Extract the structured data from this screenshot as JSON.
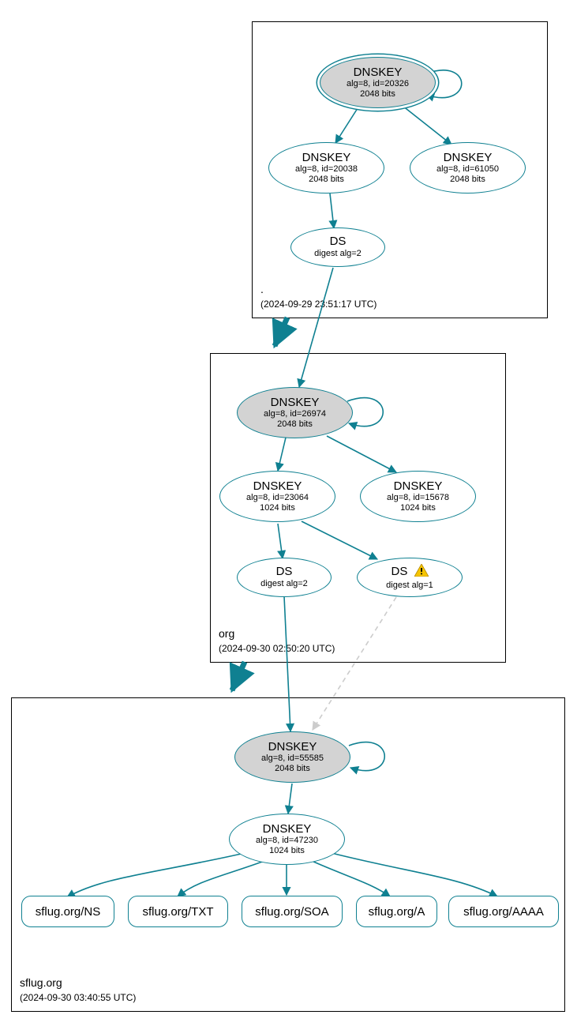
{
  "colors": {
    "stroke": "#0f8091",
    "insecure": "#cccccc"
  },
  "zones": {
    "root": {
      "name": ".",
      "timestamp": "(2024-09-29 23:51:17 UTC)"
    },
    "org": {
      "name": "org",
      "timestamp": "(2024-09-30 02:50:20 UTC)"
    },
    "sflug": {
      "name": "sflug.org",
      "timestamp": "(2024-09-30 03:40:55 UTC)"
    }
  },
  "nodes": {
    "root_ksk": {
      "title": "DNSKEY",
      "l1": "alg=8, id=20326",
      "l2": "2048 bits"
    },
    "root_zsk1": {
      "title": "DNSKEY",
      "l1": "alg=8, id=20038",
      "l2": "2048 bits"
    },
    "root_zsk2": {
      "title": "DNSKEY",
      "l1": "alg=8, id=61050",
      "l2": "2048 bits"
    },
    "root_ds": {
      "title": "DS",
      "l1": "digest alg=2"
    },
    "org_ksk": {
      "title": "DNSKEY",
      "l1": "alg=8, id=26974",
      "l2": "2048 bits"
    },
    "org_zsk1": {
      "title": "DNSKEY",
      "l1": "alg=8, id=23064",
      "l2": "1024 bits"
    },
    "org_zsk2": {
      "title": "DNSKEY",
      "l1": "alg=8, id=15678",
      "l2": "1024 bits"
    },
    "org_ds2": {
      "title": "DS",
      "l1": "digest alg=2"
    },
    "org_ds1": {
      "title": "DS",
      "l1": "digest alg=1"
    },
    "sflug_ksk": {
      "title": "DNSKEY",
      "l1": "alg=8, id=55585",
      "l2": "2048 bits"
    },
    "sflug_zsk": {
      "title": "DNSKEY",
      "l1": "alg=8, id=47230",
      "l2": "1024 bits"
    },
    "rr_ns": {
      "label": "sflug.org/NS"
    },
    "rr_txt": {
      "label": "sflug.org/TXT"
    },
    "rr_soa": {
      "label": "sflug.org/SOA"
    },
    "rr_a": {
      "label": "sflug.org/A"
    },
    "rr_aaaa": {
      "label": "sflug.org/AAAA"
    }
  }
}
